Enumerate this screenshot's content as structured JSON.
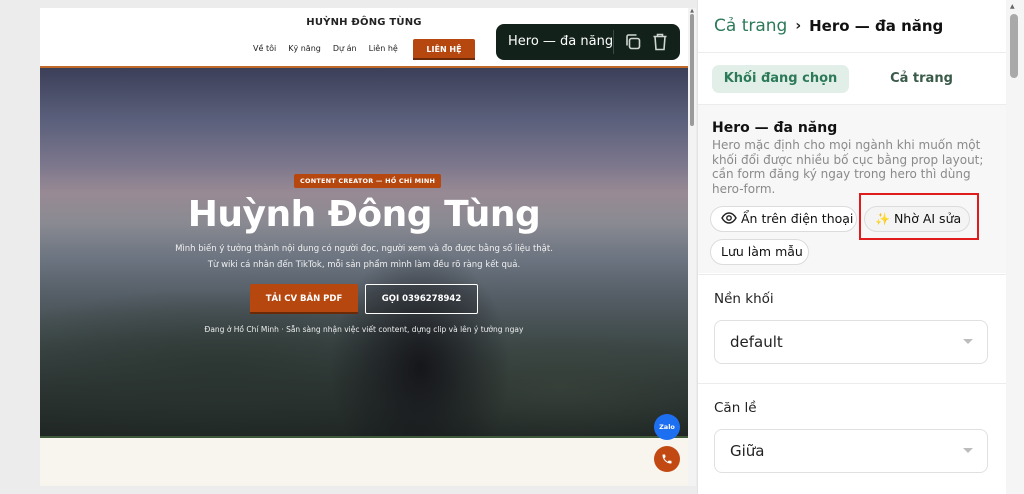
{
  "site": {
    "brand": "HUỲNH ĐÔNG TÙNG",
    "nav": [
      "Về tôi",
      "Kỹ năng",
      "Dự án",
      "Liên hệ"
    ],
    "nav_cta": "LIÊN HỆ"
  },
  "hero": {
    "badge": "CONTENT CREATOR — HỒ CHÍ MINH",
    "title": "Huỳnh Đông Tùng",
    "subtitle_line1": "Mình biến ý tưởng thành nội dung có người đọc, người xem và đo được bằng số liệu thật.",
    "subtitle_line2": "Từ wiki cá nhân đến TikTok, mỗi sản phẩm mình làm đều rõ ràng kết quả.",
    "btn_cv": "TẢI CV BẢN PDF",
    "btn_call": "GỌI 0396278942",
    "note": "Đang ở Hồ Chí Minh · Sẵn sàng nhận việc viết content, dựng clip và lên ý tưởng ngay"
  },
  "floating": {
    "zalo": "Zalo",
    "phone_icon": "phone-icon"
  },
  "toolbar": {
    "label": "Hero — đa năng",
    "copy_icon": "copy-icon",
    "delete_icon": "trash-icon"
  },
  "panel": {
    "breadcrumb_root": "Cả trang",
    "breadcrumb_sep": "›",
    "breadcrumb_current": "Hero — đa năng",
    "tab_selected": "Khối đang chọn",
    "tab_page": "Cả trang",
    "block_name": "Hero — đa năng",
    "block_desc": "Hero mặc định cho mọi ngành khi muốn một khối đổi được nhiều bố cục bằng prop layout; cần form đăng ký ngay trong hero thì dùng hero-form.",
    "chip_hide": "Ẩn trên điện thoại",
    "chip_ai": "Nhờ AI sửa",
    "chip_save": "Lưu làm mẫu",
    "bg_label": "Nền khối",
    "bg_value": "default",
    "align_label": "Căn lề",
    "align_value": "Giữa"
  },
  "colors": {
    "brand_orange": "#b5470f",
    "accent_green": "#2c7a5a",
    "toolbar_dark": "#12211a",
    "highlight_red": "#e01b1b"
  }
}
